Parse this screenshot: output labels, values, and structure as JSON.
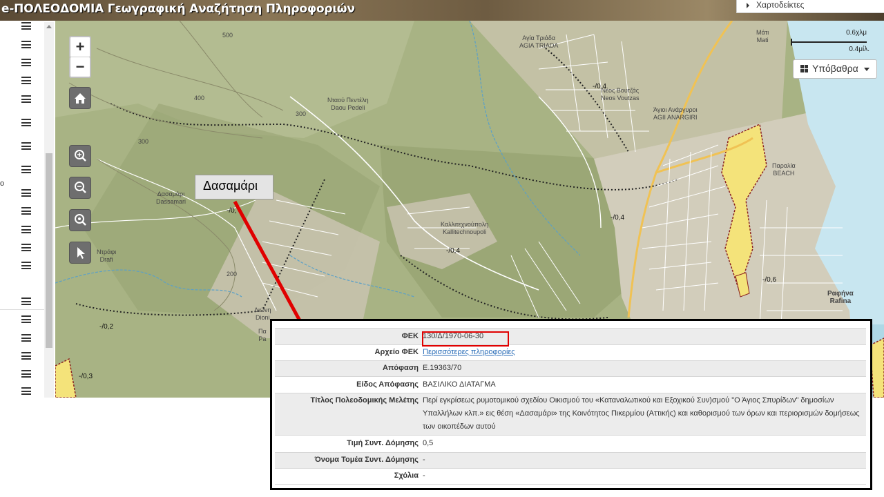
{
  "header": {
    "title": "e-ΠΟΛΕΟΔΟΜΙΑ Γεωγραφική Αναζήτηση Πληροφοριών"
  },
  "maps_menu": {
    "label": "Χαρτοδείκτες"
  },
  "sidebar": {
    "letter": "ο"
  },
  "map": {
    "zoom_in": "+",
    "zoom_out": "−",
    "basemap_label": "Υπόβαθρα",
    "scale_km": "0.6χλμ",
    "scale_mi": "0.4μίλ.",
    "callout": "Δασαμάρι",
    "places": {
      "agia_triada": "Αγία Τριάδα\nAGIA TRIADA",
      "ntaou": "Νταού Πεντέλη\nDaou Pedeli",
      "neos_voutzas": "Νέος Βουτζάς\nNeos Voutzas",
      "agios_anargyroi": "Άγιοι Ανάργυροι\nAGII ANARGIRI",
      "mati": "Μάτι\nMati",
      "paralia": "Παραλία\nBEACH",
      "dasamari": "Δασαμάρι\nDassamari",
      "ntrafi": "Ντράφι\nDrafi",
      "kallitechnoupoli": "Καλλιτεχνούπολη\nKallitechnoupoli",
      "dioni": "Διώνη\nDioni",
      "rafina": "Ραφήνα\nRafina",
      "pa": "Πα\nPa"
    },
    "contours": [
      "500",
      "400",
      "300",
      "300",
      "200"
    ],
    "coef_labels": [
      "-/0,4",
      "-/0,",
      "-/0,4",
      "-/0,4",
      "-/0,6",
      "-/0,2",
      "-/0,3"
    ]
  },
  "panel": {
    "rows": [
      {
        "key": "ΦΕΚ",
        "value": "130/Δ/1970-06-30"
      },
      {
        "key": "Αρχείο ΦΕΚ",
        "value": "Περισσότερες πληροφορίες"
      },
      {
        "key": "Απόφαση",
        "value": "Ε.19363/70"
      },
      {
        "key": "Είδος Απόφασης",
        "value": "ΒΑΣΙΛΙΚΟ ΔΙΑΤΑΓΜΑ"
      },
      {
        "key": "Τίτλος Πολεοδομικής Μελέτης",
        "value": "Περί εγκρίσεως ρυμοτομικού σχεδίου Οικισμού του «Καταναλωτικού και Εξοχικού Συν)σμού \"Ο Άγιος Σπυρίδων\" δημοσίων Υπαλλήλων κλπ.» εις θέση «Δασαμάρι» της Κοινότητος Πικερμίου (Αττικής) και καθορισμού των όρων και περιορισμών δομήσεως των οικοπέδων αυτού"
      },
      {
        "key": "Τιμή Συντ. Δόμησης",
        "value": "0,5"
      },
      {
        "key": "Όνομα Τομέα Συντ. Δόμησης",
        "value": "-"
      },
      {
        "key": "Σχόλια",
        "value": "-"
      }
    ]
  },
  "colors": {
    "highlight": "#e00000",
    "arrow": "#e00000",
    "link": "#2a6db8"
  }
}
